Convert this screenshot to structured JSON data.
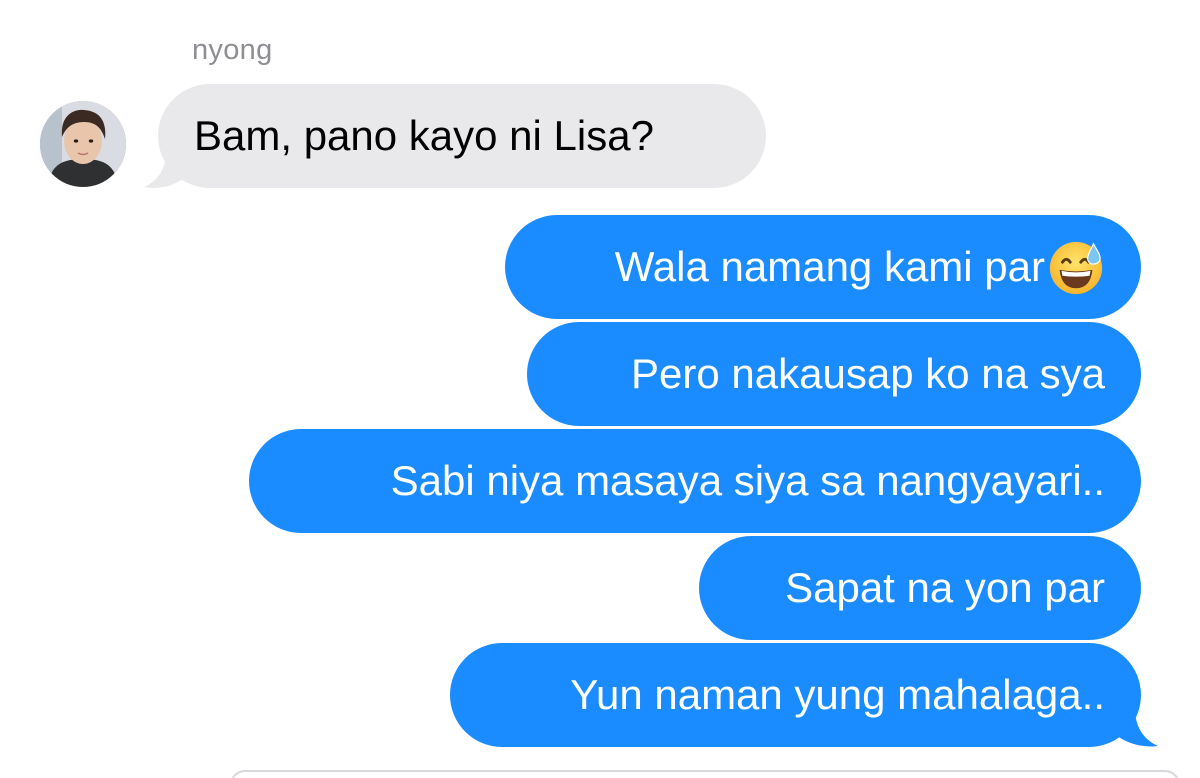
{
  "conversation": {
    "sender_name": "nyong",
    "incoming": [
      {
        "text": "Bam, pano kayo ni Lisa?"
      }
    ],
    "outgoing": [
      {
        "text": "Wala namang kami par",
        "emoji": "grinning-face-with-sweat"
      },
      {
        "text": "Pero nakausap ko na sya"
      },
      {
        "text": "Sabi niya masaya siya sa nangyayari.."
      },
      {
        "text": "Sapat na yon par"
      },
      {
        "text": "Yun naman yung mahalaga.."
      }
    ]
  },
  "colors": {
    "outgoing_bubble": "#1a8cff",
    "incoming_bubble": "#e9e9eb",
    "sender_name": "#8e8e93"
  }
}
